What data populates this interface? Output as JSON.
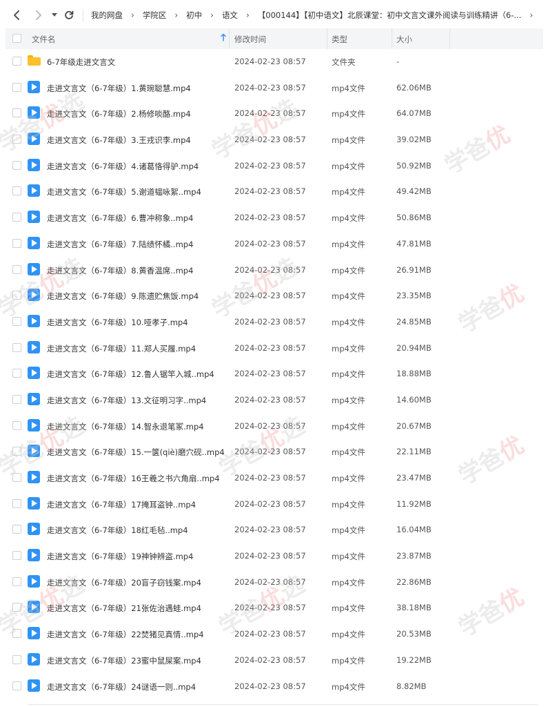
{
  "nav": {
    "back_icon": "chevron-left-icon",
    "forward_icon": "chevron-right-icon",
    "history_icon": "caret-down-icon",
    "refresh_icon": "refresh-icon"
  },
  "breadcrumb": [
    "我的网盘",
    "学院区",
    "初中",
    "语文",
    "【000144】【初中语文】北辰课堂：初中文言文课外阅读与训练精讲（6-...",
    ""
  ],
  "columns": {
    "name": "文件名",
    "modified": "修改时间",
    "type": "类型",
    "size": "大小"
  },
  "rows": [
    {
      "name": "6-7年级走进文言文",
      "date": "2024-02-23 08:57",
      "type": "文件夹",
      "size": "-",
      "icon": "folder-icon"
    },
    {
      "name": "走进文言文（6-7年级）1.黄琬聪慧.mp4",
      "date": "2024-02-23 08:57",
      "type": "mp4文件",
      "size": "62.06MB",
      "icon": "video-file-icon"
    },
    {
      "name": "走进文言文（6-7年级）2.杨修啖酪.mp4",
      "date": "2024-02-23 08:57",
      "type": "mp4文件",
      "size": "64.07MB",
      "icon": "video-file-icon"
    },
    {
      "name": "走进文言文（6-7年级）3.王戎识李.mp4",
      "date": "2024-02-23 08:57",
      "type": "mp4文件",
      "size": "39.02MB",
      "icon": "video-file-icon"
    },
    {
      "name": "走进文言文（6-7年级）4.诸葛恪得驴.mp4",
      "date": "2024-02-23 08:57",
      "type": "mp4文件",
      "size": "50.92MB",
      "icon": "video-file-icon"
    },
    {
      "name": "走进文言文（6-7年级）5.谢道韫咏絮..mp4",
      "date": "2024-02-23 08:57",
      "type": "mp4文件",
      "size": "49.42MB",
      "icon": "video-file-icon"
    },
    {
      "name": "走进文言文（6-7年级）6.曹冲称象..mp4",
      "date": "2024-02-23 08:57",
      "type": "mp4文件",
      "size": "50.86MB",
      "icon": "video-file-icon"
    },
    {
      "name": "走进文言文（6-7年级）7.陆绩怀橘..mp4",
      "date": "2024-02-23 08:57",
      "type": "mp4文件",
      "size": "47.81MB",
      "icon": "video-file-icon"
    },
    {
      "name": "走进文言文（6-7年级）8.黄香温席..mp4",
      "date": "2024-02-23 08:57",
      "type": "mp4文件",
      "size": "26.91MB",
      "icon": "video-file-icon"
    },
    {
      "name": "走进文言文（6-7年级）9.陈遗贮焦饭.mp4",
      "date": "2024-02-23 08:57",
      "type": "mp4文件",
      "size": "23.35MB",
      "icon": "video-file-icon"
    },
    {
      "name": "走进文言文（6-7年级）10.哑孝子.mp4",
      "date": "2024-02-23 08:57",
      "type": "mp4文件",
      "size": "24.85MB",
      "icon": "video-file-icon"
    },
    {
      "name": "走进文言文（6-7年级）11.郑人买履.mp4",
      "date": "2024-02-23 08:57",
      "type": "mp4文件",
      "size": "20.94MB",
      "icon": "video-file-icon"
    },
    {
      "name": "走进文言文（6-7年级）12.鲁人锯竿入城..mp4",
      "date": "2024-02-23 08:57",
      "type": "mp4文件",
      "size": "18.88MB",
      "icon": "video-file-icon"
    },
    {
      "name": "走进文言文（6-7年级）13.文征明习字..mp4",
      "date": "2024-02-23 08:57",
      "type": "mp4文件",
      "size": "14.60MB",
      "icon": "video-file-icon"
    },
    {
      "name": "走进文言文（6-7年级）14.智永退笔冢.mp4",
      "date": "2024-02-23 08:57",
      "type": "mp4文件",
      "size": "20.67MB",
      "icon": "video-file-icon"
    },
    {
      "name": "走进文言文（6-7年级）15.一箧(qiè)磨穴砚..mp4",
      "date": "2024-02-23 08:57",
      "type": "mp4文件",
      "size": "22.11MB",
      "icon": "video-file-icon"
    },
    {
      "name": "走进文言文（6-7年级）16王羲之书六角扇..mp4",
      "date": "2024-02-23 08:57",
      "type": "mp4文件",
      "size": "23.47MB",
      "icon": "video-file-icon"
    },
    {
      "name": "走进文言文（6-7年级）17掩耳盗钟..mp4",
      "date": "2024-02-23 08:57",
      "type": "mp4文件",
      "size": "11.92MB",
      "icon": "video-file-icon"
    },
    {
      "name": "走进文言文（6-7年级）18红毛毡..mp4",
      "date": "2024-02-23 08:57",
      "type": "mp4文件",
      "size": "16.04MB",
      "icon": "video-file-icon"
    },
    {
      "name": "走进文言文（6-7年级）19神钟辨盗.mp4",
      "date": "2024-02-23 08:57",
      "type": "mp4文件",
      "size": "23.87MB",
      "icon": "video-file-icon"
    },
    {
      "name": "走进文言文（6-7年级）20盲子窃钱案.mp4",
      "date": "2024-02-23 08:57",
      "type": "mp4文件",
      "size": "22.86MB",
      "icon": "video-file-icon"
    },
    {
      "name": "走进文言文（6-7年级）21张佐治遇蛙.mp4",
      "date": "2024-02-23 08:57",
      "type": "mp4文件",
      "size": "38.18MB",
      "icon": "video-file-icon"
    },
    {
      "name": "走进文言文（6-7年级）22焚猪见真情..mp4",
      "date": "2024-02-23 08:57",
      "type": "mp4文件",
      "size": "20.53MB",
      "icon": "video-file-icon"
    },
    {
      "name": "走进文言文（6-7年级）23蜜中鼠屎案.mp4",
      "date": "2024-02-23 08:57",
      "type": "mp4文件",
      "size": "19.22MB",
      "icon": "video-file-icon"
    },
    {
      "name": "走进文言文（6-7年级）24谜语一则..mp4",
      "date": "2024-02-23 08:57",
      "type": "mp4文件",
      "size": "8.82MB",
      "icon": "video-file-icon"
    }
  ],
  "watermark": {
    "text_a": "学爸",
    "text_b": "优",
    "text_c": "选"
  },
  "colors": {
    "accent": "#2f93f4",
    "folder": "#fbc02d",
    "header_bg": "#f4f5f7"
  }
}
